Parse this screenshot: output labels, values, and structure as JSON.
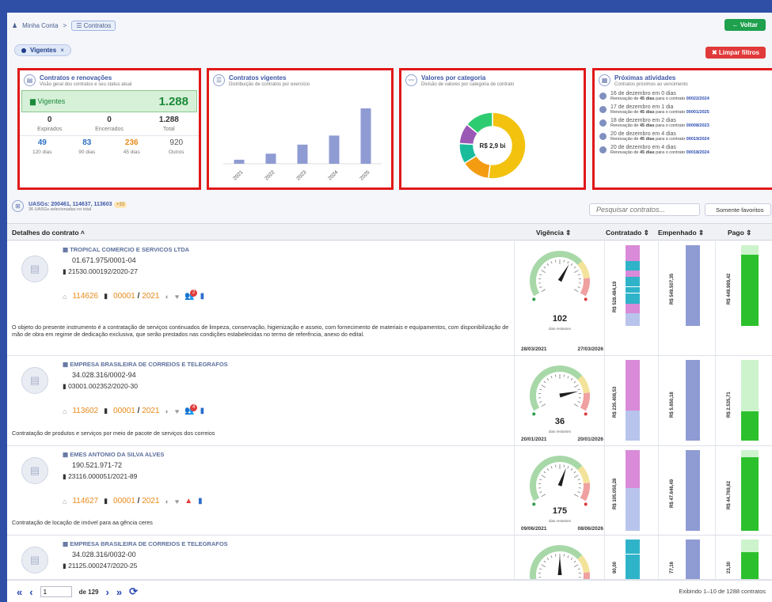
{
  "breadcrumb": {
    "home": "Minha Conta",
    "sep": ">",
    "current": "Contratos"
  },
  "header": {
    "back_label": "Voltar",
    "clear_label": "Limpar filtros"
  },
  "filter_chip": {
    "label": "Vigentes",
    "remove": "×"
  },
  "cards": {
    "contratos": {
      "title": "Contratos e renovações",
      "subtitle": "Visão geral dos contratos e seu status atual",
      "vigentes_label": "Vigentes",
      "vigentes_value": "1.288",
      "expirados_value": "0",
      "expirados_label": "Expirados",
      "encerrados_value": "0",
      "encerrados_label": "Encerrados",
      "total_value": "1.288",
      "total_label": "Total",
      "d120_value": "49",
      "d120_label": "120 dias",
      "d90_value": "83",
      "d90_label": "90 dias",
      "d45_value": "236",
      "d45_label": "45 dias",
      "outros_value": "920",
      "outros_label": "Outros"
    },
    "vigentes": {
      "title": "Contratos vigentes",
      "subtitle": "Distribuição de contratos por exercício"
    },
    "categoria": {
      "title": "Valores por categoria",
      "subtitle": "Divisão de valores por categoria de contrato",
      "center": "R$ 2,9 bi"
    },
    "atividades": {
      "title": "Próximas atividades",
      "subtitle": "Contratos próximos ao vencimento",
      "items": [
        {
          "date": "16 de dezembro em 0 dias",
          "pre": "Renovação de ",
          "bold": "45 dias",
          "mid": " para o contrato ",
          "contract": "00022/2024"
        },
        {
          "date": "17 de dezembro em 1 dia",
          "pre": "Renovação de ",
          "bold": "45 dias",
          "mid": " para o contrato ",
          "contract": "00001/2025"
        },
        {
          "date": "18 de dezembro em 2 dias",
          "pre": "Renovação de ",
          "bold": "45 dias",
          "mid": " para o contrato ",
          "contract": "00008/2023"
        },
        {
          "date": "20 de dezembro em 4 dias",
          "pre": "Renovação de ",
          "bold": "45 dias",
          "mid": " para o contrato ",
          "contract": "00019/2024"
        },
        {
          "date": "20 de dezembro em 4 dias",
          "pre": "Renovação de ",
          "bold": "45 dias",
          "mid": " para o contrato ",
          "contract": "00018/2024"
        }
      ]
    }
  },
  "chart_data": [
    {
      "type": "bar",
      "categories": [
        "2021",
        "2022",
        "2023",
        "2024",
        "2025"
      ],
      "values": [
        4,
        10,
        19,
        28,
        55
      ],
      "color": "#8f9bd3"
    },
    {
      "type": "pie",
      "values": [
        52,
        14,
        10,
        10,
        14
      ],
      "colors": [
        "#f2c20f",
        "#f39c12",
        "#1abc9c",
        "#9b59b6",
        "#2ecc71"
      ]
    }
  ],
  "uasgs": {
    "title": "UASGs: 200461, 114637, 113603",
    "badge": "+33",
    "subtitle": "36 UASGs selecionadas no total"
  },
  "search": {
    "placeholder": "Pesquisar contratos..."
  },
  "favorites_label": "Somente favoritos",
  "table": {
    "h_detalhes": "Detalhes do contrato ˄",
    "h_vigencia": "Vigência ⇕",
    "h_contratado": "Contratado ⇕",
    "h_empenhado": "Empenhado ⇕",
    "h_pago": "Pago ⇕"
  },
  "rows": [
    {
      "company": "TROPICAL COMERCIO E SERVICOS LTDA",
      "cnpj": "01.671.975/0001-04",
      "process": "21530.000192/2020-27",
      "uasg": "114626",
      "num": "00001",
      "slash": " / ",
      "year": "2021",
      "badge": "2",
      "desc": "O objeto do presente instrumento é a contratação de serviços continuados de limpeza, conservação, higienização e asseio, com fornecimento de materiais e equipamentos, com disponibilização de mão de obra em regime de dedicação exclusiva, que serão prestados nas condições estabelecidas no termo de referência, anexo do edital.",
      "days": "102",
      "days_label": "dias restantes",
      "start": "28/03/2021",
      "end": "27/03/2026",
      "needle": 0.62,
      "contratado": "R$ 528.484,19",
      "empenhado": "R$ 549.507,35",
      "pago": "R$ 449.989,42"
    },
    {
      "company": "EMPRESA BRASILEIRA DE CORREIOS E TELEGRAFOS",
      "cnpj": "34.028.316/0002-94",
      "process": "03001.002352/2020-30",
      "uasg": "113602",
      "num": "00001",
      "slash": " / ",
      "year": "2021",
      "badge": "4",
      "desc": "Contratação de produtos e serviços por meio de pacote de serviços dos correios",
      "days": "36",
      "days_label": "dias restantes",
      "start": "20/01/2021",
      "end": "20/01/2026",
      "needle": 0.82,
      "contratado": "R$ 235.408,53",
      "empenhado": "R$ 5.650,18",
      "pago": "R$ 2.535,71"
    },
    {
      "company": "EMES ANTONIO DA SILVA ALVES",
      "cnpj": "190.521.971-72",
      "process": "23116.000051/2021-89",
      "uasg": "114627",
      "num": "00001",
      "slash": " / ",
      "year": "2021",
      "badge": "",
      "desc": "Contratação de locação de imóvel para aa gência ceres",
      "days": "175",
      "days_label": "dias restantes",
      "start": "09/06/2021",
      "end": "08/06/2026",
      "needle": 0.58,
      "contratado": "R$ 105.050,28",
      "empenhado": "R$ 47.646,49",
      "pago": "R$ 44.769,62"
    },
    {
      "company": "EMPRESA BRASILEIRA DE CORREIOS E TELEGRAFOS",
      "cnpj": "34.028.316/0032-00",
      "process": "21125.000247/2020-25",
      "contratado": "90,00",
      "empenhado": "77,16",
      "pago": "23,30"
    }
  ],
  "pagination": {
    "first": "«",
    "prev": "‹",
    "page": "1",
    "of": "de 129",
    "next": "›",
    "last": "»",
    "refresh": "⟳",
    "showing": "Exibindo 1–10 de 1288 contratos"
  }
}
